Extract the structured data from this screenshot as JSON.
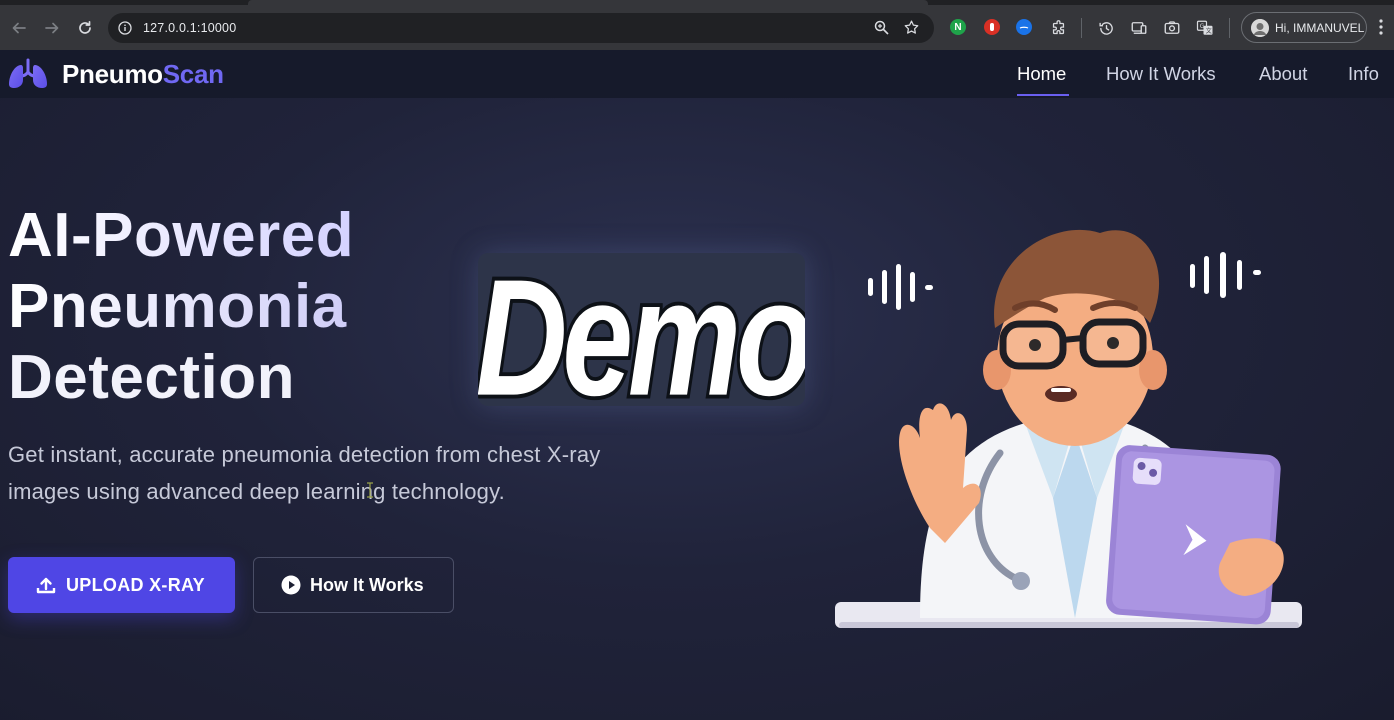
{
  "browser": {
    "url": "127.0.0.1:10000",
    "profile_label": "Hi, IMMANUVEL",
    "extensions": [
      {
        "icon": "grammar-extension-icon",
        "color": "#1fa34a",
        "glyph": "N"
      },
      {
        "icon": "hand-extension-icon",
        "color": "#d93025",
        "glyph": ""
      },
      {
        "icon": "globe-extension-icon",
        "color": "#1a73e8",
        "glyph": ""
      }
    ]
  },
  "site": {
    "brand_first": "Pneumo",
    "brand_second": "Scan",
    "nav": {
      "home": "Home",
      "how_it_works": "How It Works",
      "about": "About",
      "info": "Info"
    },
    "active_nav": "Home"
  },
  "hero": {
    "title_line1": "AI-Powered",
    "title_line2": "Pneumonia",
    "title_line3": "Detection",
    "subtitle": "Get instant, accurate pneumonia detection from chest X-ray images using advanced deep learning technology.",
    "upload_button": "UPLOAD X-RAY",
    "how_button": "How It Works",
    "demo_badge": "Demo"
  },
  "colors": {
    "accent": "#4f46e5",
    "brand_accent": "#7068f2",
    "header_bg": "#161a2b",
    "hero_bg": "#20233a"
  }
}
